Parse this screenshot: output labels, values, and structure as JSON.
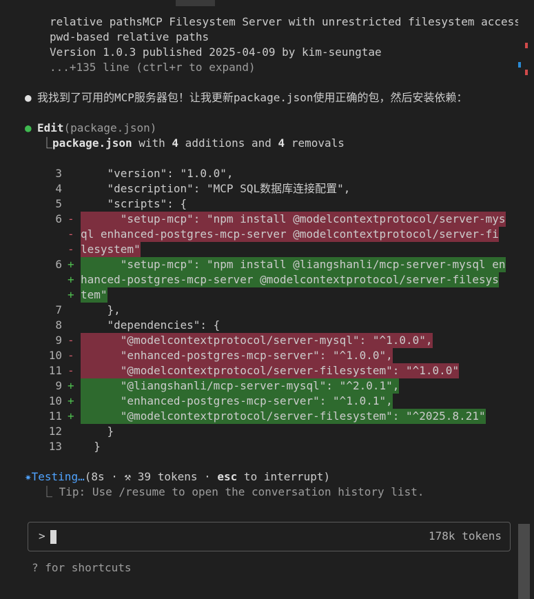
{
  "search_result": {
    "line1": "relative pathsMCP Filesystem Server with unrestricted filesystem access and",
    "line2": "pwd-based relative paths",
    "line3": "Version 1.0.3 published 2025-04-09 by kim-seungtae",
    "line4": "...+135 line (ctrl+r to expand)"
  },
  "message": {
    "bullet": "●",
    "text": "我找到了可用的MCP服务器包！让我更新package.json使用正确的包，然后安装依赖："
  },
  "edit": {
    "bullet": "●",
    "tool": "Edit",
    "arg": "(package.json)",
    "summary_prefix": "⎿",
    "summary_file": "package.json",
    "summary_with": " with ",
    "additions": "4",
    "summary_mid": " additions and ",
    "removals": "4",
    "summary_end": " removals",
    "colors": {
      "bullet": "#3fb950",
      "del_bg": "#7d2f3f",
      "add_bg": "#2e6a2e"
    }
  },
  "diff": [
    {
      "ln": "3",
      "sign": "",
      "kind": "ctx",
      "text": "    \"version\": \"1.0.0\","
    },
    {
      "ln": "4",
      "sign": "",
      "kind": "ctx",
      "text": "    \"description\": \"MCP SQL数据库连接配置\","
    },
    {
      "ln": "5",
      "sign": "",
      "kind": "ctx",
      "text": "    \"scripts\": {"
    },
    {
      "ln": "6",
      "sign": "-",
      "kind": "del",
      "text": "      \"setup-mcp\": \"npm install @modelcontextprotocol/server-mys"
    },
    {
      "ln": "",
      "sign": "-",
      "kind": "del",
      "text": "ql enhanced-postgres-mcp-server @modelcontextprotocol/server-fi"
    },
    {
      "ln": "",
      "sign": "-",
      "kind": "del",
      "text": "lesystem\""
    },
    {
      "ln": "6",
      "sign": "+",
      "kind": "add",
      "text": "      \"setup-mcp\": \"npm install @liangshanli/mcp-server-mysql en"
    },
    {
      "ln": "",
      "sign": "+",
      "kind": "add",
      "text": "hanced-postgres-mcp-server @modelcontextprotocol/server-filesys"
    },
    {
      "ln": "",
      "sign": "+",
      "kind": "add",
      "text": "tem\""
    },
    {
      "ln": "7",
      "sign": "",
      "kind": "ctx",
      "text": "    },"
    },
    {
      "ln": "8",
      "sign": "",
      "kind": "ctx",
      "text": "    \"dependencies\": {"
    },
    {
      "ln": "9",
      "sign": "-",
      "kind": "del",
      "text": "      \"@modelcontextprotocol/server-mysql\": \"^1.0.0\","
    },
    {
      "ln": "10",
      "sign": "-",
      "kind": "del",
      "text": "      \"enhanced-postgres-mcp-server\": \"^1.0.0\","
    },
    {
      "ln": "11",
      "sign": "-",
      "kind": "del",
      "text": "      \"@modelcontextprotocol/server-filesystem\": \"^1.0.0\""
    },
    {
      "ln": "9",
      "sign": "+",
      "kind": "add",
      "text": "      \"@liangshanli/mcp-server-mysql\": \"^2.0.1\","
    },
    {
      "ln": "10",
      "sign": "+",
      "kind": "add",
      "text": "      \"enhanced-postgres-mcp-server\": \"^1.0.1\","
    },
    {
      "ln": "11",
      "sign": "+",
      "kind": "add",
      "text": "      \"@modelcontextprotocol/server-filesystem\": \"^2025.8.21\""
    },
    {
      "ln": "12",
      "sign": "",
      "kind": "ctx",
      "text": "    }"
    },
    {
      "ln": "13",
      "sign": "",
      "kind": "ctx",
      "text": "  }"
    }
  ],
  "status": {
    "star": "✷",
    "label": "Testing…",
    "open": "(",
    "seconds": "8s",
    "sep1": " · ",
    "hammer": "⚒",
    "tokens": " 39 tokens",
    "sep2": " · ",
    "key": "esc",
    "interrupt": " to interrupt)",
    "tip_prefix": "⎿",
    "tip": "Tip: Use /resume to open the conversation history list."
  },
  "input": {
    "prompt": ">",
    "token_count": "178k tokens"
  },
  "footer": {
    "shortcuts": "? for shortcuts"
  }
}
